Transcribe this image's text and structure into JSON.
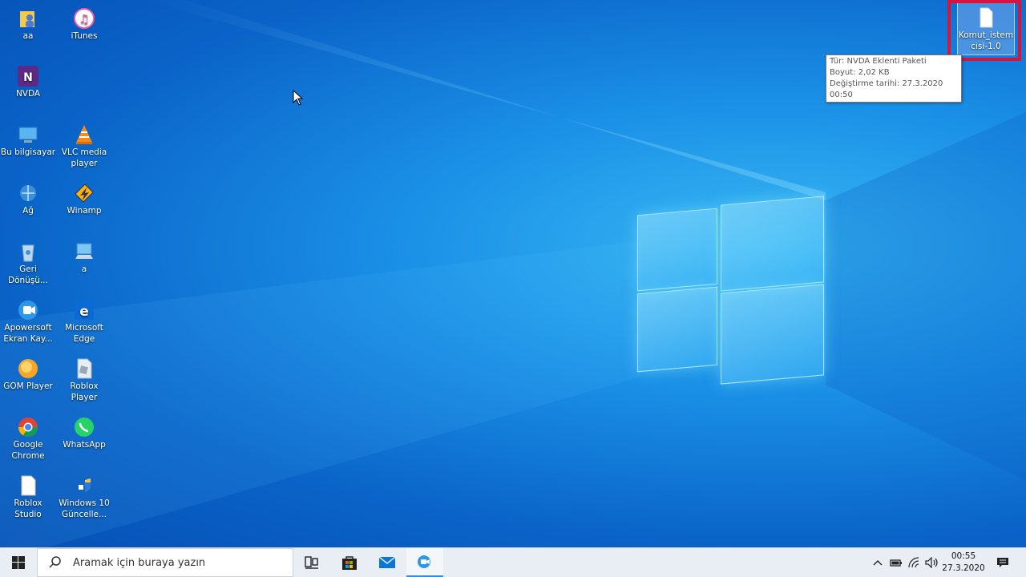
{
  "desktop": {
    "icons": [
      {
        "label": "aa",
        "icon": "user-folder-icon"
      },
      {
        "label": "iTunes",
        "icon": "itunes-icon"
      },
      {
        "label": "NVDA",
        "icon": "nvda-icon"
      },
      {
        "label": "Bu bilgisayar",
        "icon": "this-pc-icon"
      },
      {
        "label": "VLC media player",
        "icon": "vlc-icon"
      },
      {
        "label": "Ağ",
        "icon": "network-icon"
      },
      {
        "label": "Winamp",
        "icon": "winamp-icon"
      },
      {
        "label": "Geri Dönüşü...",
        "icon": "recycle-bin-icon"
      },
      {
        "label": "a",
        "icon": "computer-icon"
      },
      {
        "label": "Apowersoft Ekran Kay...",
        "icon": "apowersoft-icon"
      },
      {
        "label": "Microsoft Edge",
        "icon": "edge-icon"
      },
      {
        "label": "GOM Player",
        "icon": "gom-player-icon"
      },
      {
        "label": "Roblox Player",
        "icon": "roblox-player-icon"
      },
      {
        "label": "Google Chrome",
        "icon": "chrome-icon"
      },
      {
        "label": "WhatsApp",
        "icon": "whatsapp-icon"
      },
      {
        "label": "Roblox Studio",
        "icon": "roblox-studio-icon"
      },
      {
        "label": "Windows 10 Güncelle...",
        "icon": "windows-update-icon"
      }
    ],
    "selected_icon": {
      "label": "Komut_istem cisi-1.0",
      "icon": "file-icon"
    },
    "tooltip": {
      "type": "Tür: NVDA Eklenti Paketi",
      "size": "Boyut: 2,02 KB",
      "modified": "Değiştirme tarihi: 27.3.2020 00:50"
    }
  },
  "taskbar": {
    "start_icon": "windows-start-icon",
    "search_placeholder": "Aramak için buraya yazın",
    "apps": [
      "task-view-icon",
      "store-icon",
      "mail-icon",
      "screen-recorder-icon"
    ],
    "tray": [
      "chevron-up-icon",
      "battery-icon",
      "wifi-icon",
      "volume-icon"
    ],
    "clock": {
      "time": "00:55",
      "date": "27.3.2020"
    },
    "notification_icon": "action-center-icon"
  },
  "colors": {
    "wallpaper": "#1a8fe6",
    "highlight": "#d9143c",
    "taskbar": "#e9eef4"
  }
}
